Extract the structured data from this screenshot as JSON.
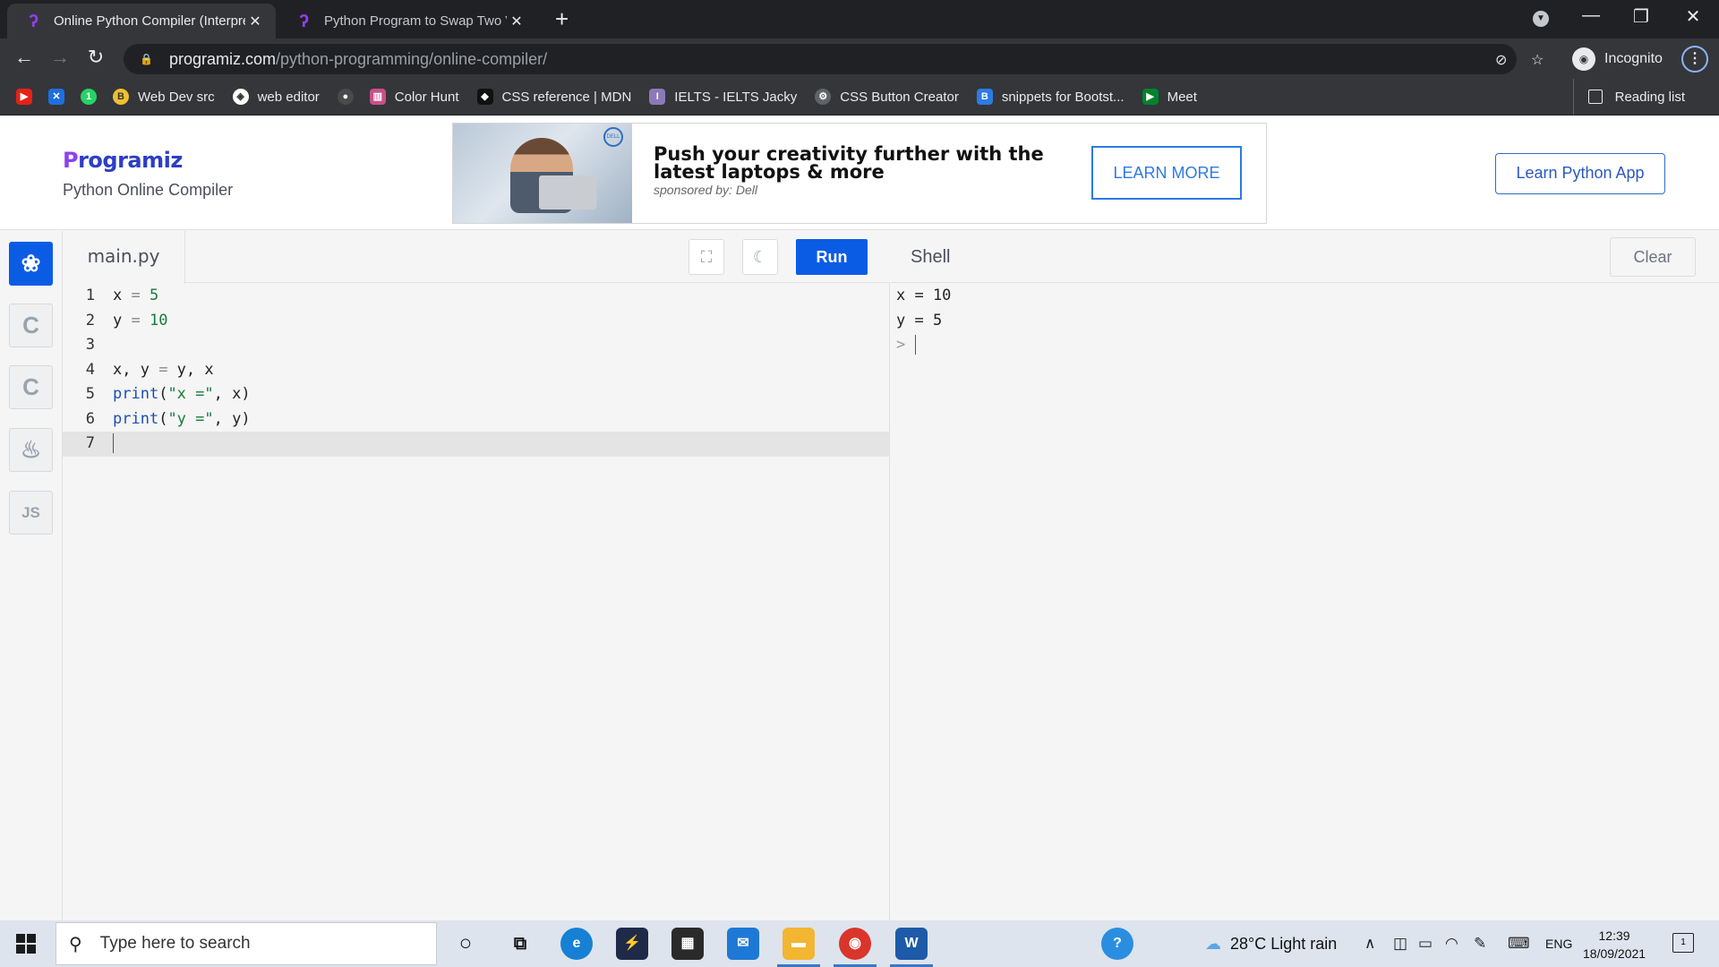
{
  "browser": {
    "tabs": [
      {
        "title": "Online Python Compiler (Interpre"
      },
      {
        "title": "Python Program to Swap Two Va"
      }
    ],
    "url_host": "programiz.com",
    "url_path": "/python-programming/online-compiler/",
    "profile_label": "Incognito",
    "bookmarks": [
      {
        "label": "",
        "icon": "youtube-icon",
        "color": "#e62117"
      },
      {
        "label": "",
        "icon": "x-icon",
        "color": "#1d6fe0"
      },
      {
        "label": "",
        "icon": "whatsapp-icon",
        "color": "#25d366"
      },
      {
        "label": "Web Dev src",
        "icon": "bookmark-icon",
        "color": "#f0c030"
      },
      {
        "label": "web editor",
        "icon": "codepen-icon",
        "color": "#333333"
      },
      {
        "label": "",
        "icon": "github-icon",
        "color": "#4a4a4a"
      },
      {
        "label": "Color Hunt",
        "icon": "colorhunt-icon",
        "color": "#c94f8a"
      },
      {
        "label": "CSS reference | MDN",
        "icon": "mdn-icon",
        "color": "#111111"
      },
      {
        "label": "IELTS  - IELTS Jacky",
        "icon": "ielts-icon",
        "color": "#8a7ab8"
      },
      {
        "label": "CSS Button Creator",
        "icon": "gear-icon",
        "color": "#5f6368"
      },
      {
        "label": "snippets for Bootst...",
        "icon": "bootstrap-icon",
        "color": "#2c7be5"
      },
      {
        "label": "Meet",
        "icon": "meet-icon",
        "color": "#00832d"
      }
    ],
    "reading_list_label": "Reading list"
  },
  "header": {
    "logo_p": "P",
    "logo_rest": "rogramiz",
    "subtitle": "Python Online Compiler",
    "ad_headline": "Push your creativity further with the latest laptops & more",
    "ad_sponsor": "sponsored by: Dell",
    "ad_cta": "LEARN MORE",
    "learn_app_button": "Learn Python App"
  },
  "sidebar": {
    "languages": [
      {
        "name": "python-language-icon",
        "glyph": "🐍",
        "active": true
      },
      {
        "name": "c-language-icon",
        "glyph": "C",
        "active": false
      },
      {
        "name": "cpp-language-icon",
        "glyph": "C",
        "active": false
      },
      {
        "name": "java-language-icon",
        "glyph": "♨",
        "active": false
      },
      {
        "name": "js-language-icon",
        "glyph": "JS",
        "active": false
      }
    ]
  },
  "editor": {
    "filename": "main.py",
    "run_label": "Run",
    "line_numbers": [
      "1",
      "2",
      "3",
      "4",
      "5",
      "6",
      "7"
    ],
    "lines": [
      "x = 5",
      "y = 10",
      "",
      "x, y = y, x",
      "print(\"x =\", x)",
      "print(\"y =\", y)",
      ""
    ],
    "current_line": 7
  },
  "shell": {
    "title": "Shell",
    "clear_label": "Clear",
    "output": [
      "x = 10",
      "y = 5"
    ],
    "prompt": ">"
  },
  "taskbar": {
    "search_placeholder": "Type here to search",
    "weather": "28°C  Light rain",
    "language": "ENG",
    "time": "12:39",
    "date": "18/09/2021",
    "notification_count": "1"
  }
}
